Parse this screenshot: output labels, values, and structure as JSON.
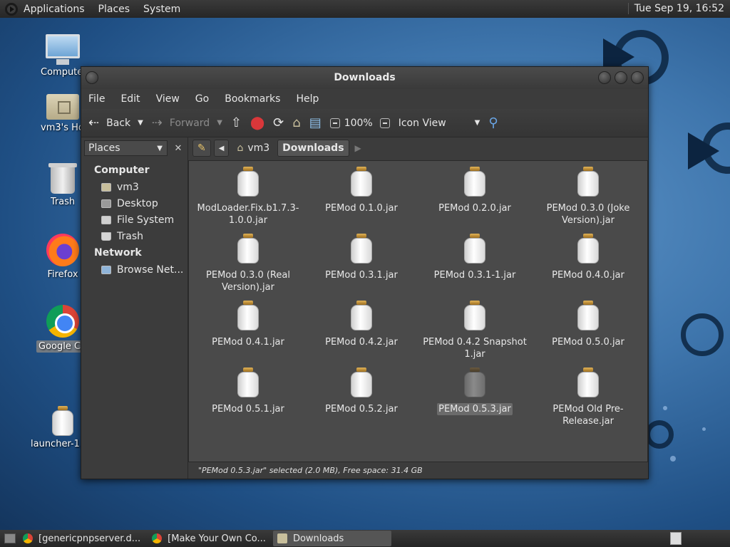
{
  "top_panel": {
    "menus": [
      "Applications",
      "Places",
      "System"
    ],
    "clock": "Tue Sep 19, 16:52"
  },
  "desktop": {
    "icons": [
      {
        "label": "Computer",
        "icon": "computer-icon"
      },
      {
        "label": "vm3's Home",
        "icon": "home-folder-icon"
      },
      {
        "label": "Trash",
        "icon": "trash-icon"
      },
      {
        "label": "Firefox",
        "icon": "firefox-icon"
      },
      {
        "label": "Google Chrome",
        "icon": "chrome-icon"
      },
      {
        "label": "launcher-1.09_",
        "icon": "jar-icon"
      }
    ]
  },
  "window": {
    "title": "Downloads",
    "menubar": [
      "File",
      "Edit",
      "View",
      "Go",
      "Bookmarks",
      "Help"
    ],
    "toolbar": {
      "back": "Back",
      "forward": "Forward",
      "zoom": "100%",
      "view_mode": "Icon View"
    },
    "sidebar": {
      "selector": "Places",
      "sections": [
        {
          "header": "Computer",
          "items": [
            "vm3",
            "Desktop",
            "File System",
            "Trash"
          ]
        },
        {
          "header": "Network",
          "items": [
            "Browse Net..."
          ]
        }
      ]
    },
    "pathbar": [
      "vm3",
      "Downloads"
    ],
    "files": [
      [
        "ModLoader.Fix.b1.7.3-",
        "1.0.0.jar"
      ],
      [
        "PEMod 0.1.0.jar"
      ],
      [
        "PEMod 0.2.0.jar"
      ],
      [
        "PEMod 0.3.0 (Joke",
        "Version).jar"
      ],
      [
        "PEMod 0.3.0 (Real",
        "Version).jar"
      ],
      [
        "PEMod 0.3.1.jar"
      ],
      [
        "PEMod 0.3.1-1.jar"
      ],
      [
        "PEMod 0.4.0.jar"
      ],
      [
        "PEMod 0.4.1.jar"
      ],
      [
        "PEMod 0.4.2.jar"
      ],
      [
        "PEMod 0.4.2 Snapshot",
        "1.jar"
      ],
      [
        "PEMod 0.5.0.jar"
      ],
      [
        "PEMod 0.5.1.jar"
      ],
      [
        "PEMod 0.5.2.jar"
      ],
      [
        "PEMod 0.5.3.jar"
      ],
      [
        "PEMod Old Pre-",
        "Release.jar"
      ]
    ],
    "selected_file_index": 14,
    "status": "\"PEMod 0.5.3.jar\" selected (2.0 MB), Free space: 31.4 GB"
  },
  "taskbar": {
    "tasks": [
      "[genericpnpserver.d...",
      "[Make Your Own Co...",
      "Downloads"
    ],
    "active_index": 2
  }
}
